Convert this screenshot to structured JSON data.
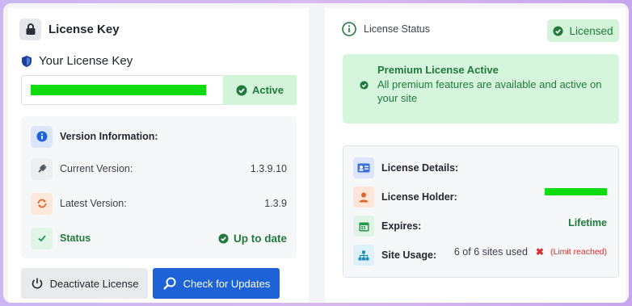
{
  "license_key": {
    "title": "License Key",
    "subtitle": "Your License Key",
    "status_badge": "Active"
  },
  "version_info": {
    "heading": "Version Information:",
    "current_label": "Current Version:",
    "current_value": "1.3.9.10",
    "latest_label": "Latest Version:",
    "latest_value": "1.3.9",
    "status_label": "Status",
    "status_value": "Up to date"
  },
  "buttons": {
    "deactivate": "Deactivate License",
    "check_updates": "Check for Updates"
  },
  "license_status": {
    "label": "License Status",
    "badge": "Licensed",
    "premium_title": "Premium License Active",
    "premium_desc": "All premium features are available and active on your site"
  },
  "details": {
    "heading": "License Details:",
    "holder_label": "License Holder:",
    "expires_label": "Expires:",
    "expires_value": "Lifetime",
    "usage_label": "Site Usage:",
    "usage_value": "6 of 6 sites used",
    "usage_limit": "(Limit reached)"
  },
  "icons": {
    "lock": "lock-icon",
    "shield": "shield-icon",
    "info": "info-icon",
    "plug": "plug-icon",
    "sync": "sync-icon",
    "check": "check-icon",
    "check_circle": "check-circle-icon",
    "power": "power-icon",
    "search": "search-icon",
    "id_card": "id-card-icon",
    "user": "user-icon",
    "calendar": "calendar-icon",
    "sitemap": "sitemap-icon",
    "x": "x-icon"
  },
  "colors": {
    "primary": "#1d63d7",
    "success": "#1f7a3c",
    "success_bg": "#d4f4d9",
    "danger": "#d92d2d",
    "mask_green": "#0fdc0f"
  }
}
